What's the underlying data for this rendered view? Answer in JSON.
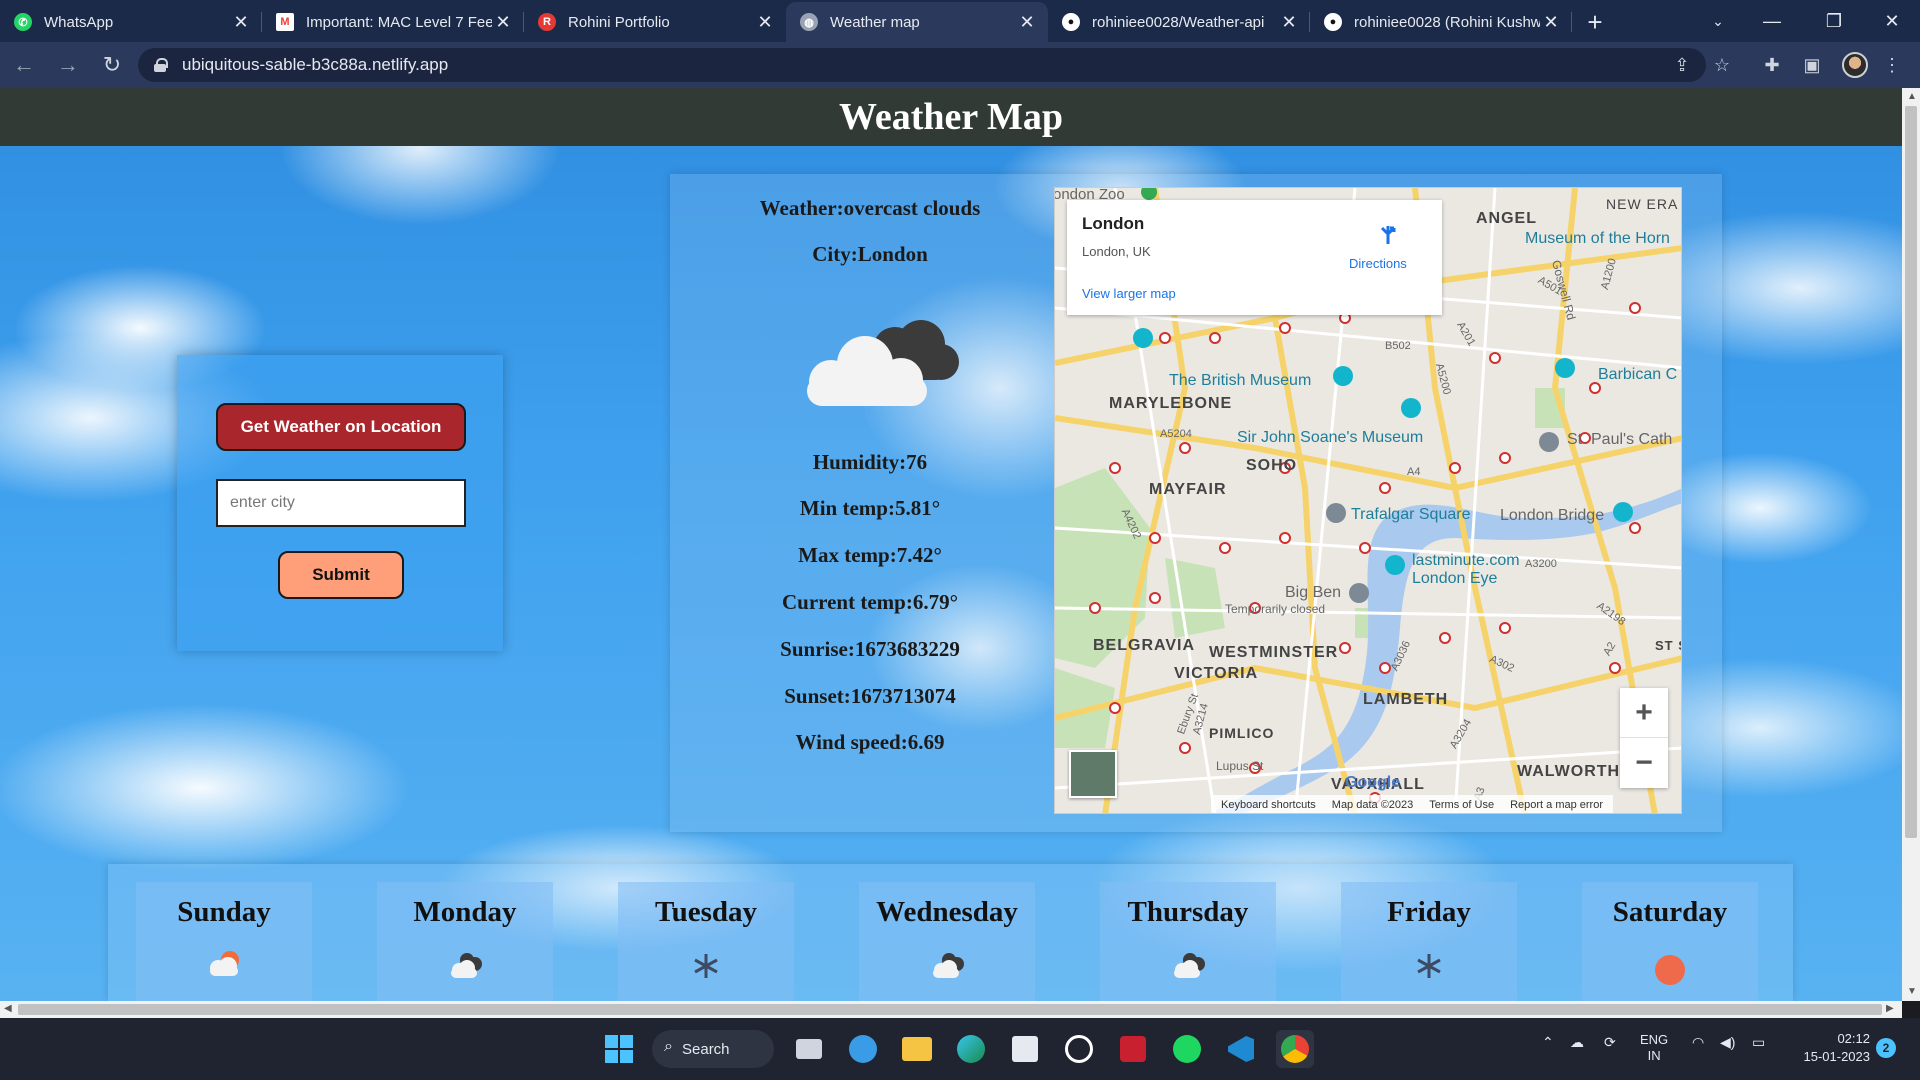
{
  "browser": {
    "tabs": [
      {
        "title": "WhatsApp",
        "favicon": "whatsapp-icon",
        "color": "#25d366"
      },
      {
        "title": "Important: MAC Level 7 Fee",
        "favicon": "gmail-icon",
        "color": "#ea4335"
      },
      {
        "title": "Rohini Portfolio",
        "favicon": "portfolio-icon",
        "color": "#e53935"
      },
      {
        "title": "Weather map",
        "favicon": "globe-icon",
        "color": "#9aa3b5",
        "active": true
      },
      {
        "title": "rohiniee0028/Weather-api",
        "favicon": "github-icon",
        "color": "#ffffff"
      },
      {
        "title": "rohiniee0028 (Rohini Kushw",
        "favicon": "github-icon",
        "color": "#ffffff"
      }
    ],
    "url": "ubiquitous-sable-b3c88a.netlify.app"
  },
  "page": {
    "title": "Weather Map",
    "controls": {
      "location_button": "Get Weather on Location",
      "city_placeholder": "enter city",
      "submit_button": "Submit"
    },
    "weather": {
      "description": "Weather:overcast clouds",
      "city": "City:London",
      "humidity": "Humidity:76",
      "min_temp": "Min temp:5.81°",
      "max_temp": "Max temp:7.42°",
      "current_temp": "Current temp:6.79°",
      "sunrise": "Sunrise:1673683229",
      "sunset": "Sunset:1673713074",
      "wind_speed": "Wind speed:6.69",
      "icon": "overcast-clouds-icon"
    },
    "map": {
      "place": "London",
      "address": "London, UK",
      "directions": "Directions",
      "larger_map": "View larger map",
      "labels": {
        "new_era": "NEW ERA",
        "angel": "ANGEL",
        "museum_horn": "Museum of the Horn",
        "british_museum": "The British Museum",
        "marylebone": "MARYLEBONE",
        "soane": "Sir John Soane's Museum",
        "soho": "SOHO",
        "mayfair": "MAYFAIR",
        "trafalgar": "Trafalgar Square",
        "london_bridge": "London Bridge",
        "st_pauls": "St. Paul's Cath",
        "barbican": "Barbican C",
        "lastminute": "lastminute.com",
        "london_eye": "London Eye",
        "big_ben": "Big Ben",
        "temporarily_closed": "Temporarily closed",
        "belgravia": "BELGRAVIA",
        "westminster": "WESTMINSTER",
        "victoria": "VICTORIA",
        "lambeth": "LAMBETH",
        "pimlico": "PIMLICO",
        "vauxhall": "VAUXHALL",
        "walworth": "WALWORTH",
        "st_s": "ST S",
        "london_zoo": "ondon Zoo",
        "goswell": "Goswell Rd",
        "lupus": "Lupus St",
        "a5204": "A5204",
        "a4202": "A4202",
        "b502": "B502",
        "a5200": "A5200",
        "a201": "A201",
        "a501": "A501",
        "a1200": "A1200",
        "a3200": "A3200",
        "a3036": "A3036",
        "a302": "A302",
        "a2198": "A2198",
        "a3204": "A3204",
        "a3214": "A3214",
        "a4": "A4",
        "a3": "A3",
        "a2": "A2",
        "ebury": "Ebury St"
      },
      "footer": {
        "shortcuts": "Keyboard shortcuts",
        "data": "Map data ©2023",
        "terms": "Terms of Use",
        "report": "Report a map error"
      },
      "google": "Google",
      "zoom_in": "+",
      "zoom_out": "−"
    },
    "days": [
      {
        "name": "Sunday",
        "icon": "partly-cloudy-sun-icon"
      },
      {
        "name": "Monday",
        "icon": "dark-cloud-icon"
      },
      {
        "name": "Tuesday",
        "icon": "snowflake-icon"
      },
      {
        "name": "Wednesday",
        "icon": "dark-cloud-icon"
      },
      {
        "name": "Thursday",
        "icon": "dark-cloud-icon"
      },
      {
        "name": "Friday",
        "icon": "snowflake-icon"
      },
      {
        "name": "Saturday",
        "icon": "sun-icon"
      }
    ]
  },
  "taskbar": {
    "search": "Search",
    "lang_top": "ENG",
    "lang_bottom": "IN",
    "time": "02:12",
    "date": "15-01-2023",
    "notifications": "2"
  },
  "colors": {
    "header_bg": "#323a36",
    "location_button": "#a8262c",
    "submit_button": "#ff9f7a"
  }
}
